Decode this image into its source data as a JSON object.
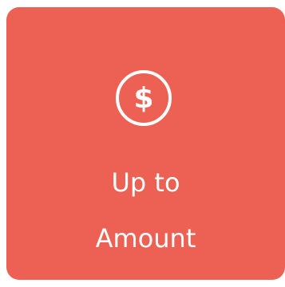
{
  "tile": {
    "background_color": "#ec6153",
    "text_color": "#ffffff",
    "icon": "dollar-circle-icon",
    "icon_glyph": "$",
    "label_lines": [
      "Up to",
      "Amount"
    ]
  }
}
